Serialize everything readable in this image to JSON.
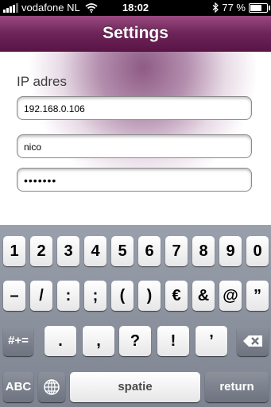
{
  "status_bar": {
    "carrier": "vodafone NL",
    "time": "18:02",
    "battery": "77 %",
    "battery_level": 0.77
  },
  "navbar": {
    "title": "Settings"
  },
  "form": {
    "ip_label": "IP adres",
    "ip_value": "192.168.0.106",
    "user_value": "nico",
    "password_value": "•••••••"
  },
  "keyboard": {
    "row1": [
      "1",
      "2",
      "3",
      "4",
      "5",
      "6",
      "7",
      "8",
      "9",
      "0"
    ],
    "row2": [
      "–",
      "/",
      ":",
      ";",
      "(",
      ")",
      "€",
      "&",
      "@",
      "”"
    ],
    "row3_mode": "#+=",
    "row3": [
      ".",
      ",",
      "?",
      "!",
      "’"
    ],
    "abc": "ABC",
    "space": "spatie",
    "return": "return"
  }
}
